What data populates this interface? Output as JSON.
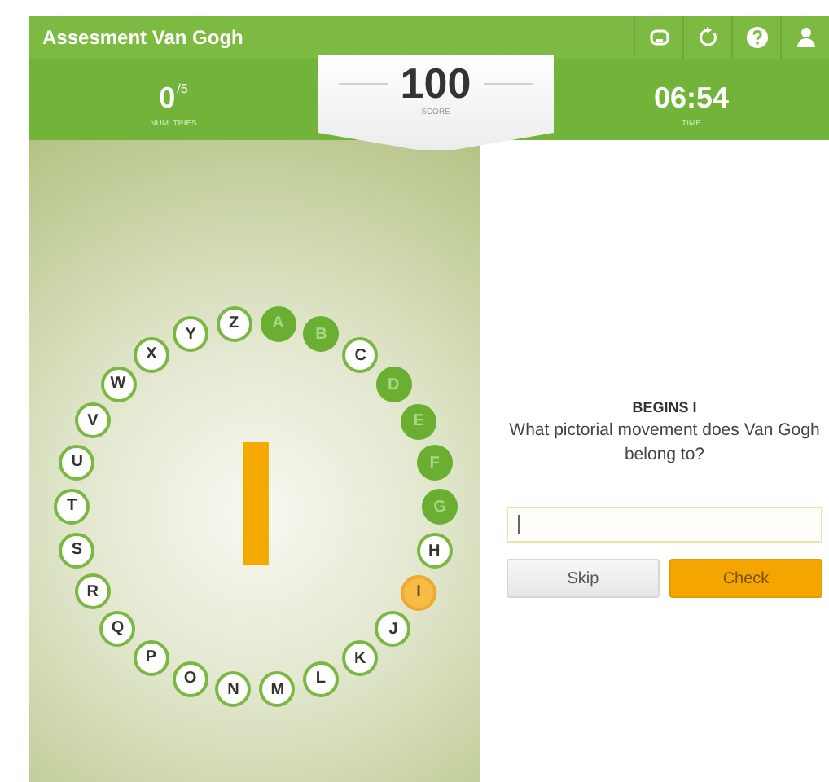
{
  "window": {
    "title": "Assesment Van Gogh"
  },
  "stats": {
    "tries": "0",
    "tries_max": "/5",
    "tries_label": "NUM. TRIES",
    "score": "100",
    "score_label": "SCORE",
    "time": "06:54",
    "time_label": "TIME"
  },
  "wheel": {
    "current": "I",
    "letters": [
      {
        "letter": "A",
        "kind": "correct"
      },
      {
        "letter": "B",
        "kind": "correct"
      },
      {
        "letter": "C",
        "kind": "pending"
      },
      {
        "letter": "D",
        "kind": "correct"
      },
      {
        "letter": "E",
        "kind": "correct"
      },
      {
        "letter": "F",
        "kind": "correct"
      },
      {
        "letter": "G",
        "kind": "correct"
      },
      {
        "letter": "H",
        "kind": "pending"
      },
      {
        "letter": "I",
        "kind": "current"
      },
      {
        "letter": "J",
        "kind": "pending"
      },
      {
        "letter": "K",
        "kind": "pending"
      },
      {
        "letter": "L",
        "kind": "pending"
      },
      {
        "letter": "M",
        "kind": "pending"
      },
      {
        "letter": "N",
        "kind": "pending"
      },
      {
        "letter": "O",
        "kind": "pending"
      },
      {
        "letter": "P",
        "kind": "pending"
      },
      {
        "letter": "Q",
        "kind": "pending"
      },
      {
        "letter": "R",
        "kind": "pending"
      },
      {
        "letter": "S",
        "kind": "pending"
      },
      {
        "letter": "T",
        "kind": "pending"
      },
      {
        "letter": "U",
        "kind": "pending"
      },
      {
        "letter": "V",
        "kind": "pending"
      },
      {
        "letter": "W",
        "kind": "pending"
      },
      {
        "letter": "X",
        "kind": "pending"
      },
      {
        "letter": "Y",
        "kind": "pending"
      },
      {
        "letter": "Z",
        "kind": "pending"
      }
    ]
  },
  "question": {
    "heading": "BEGINS I",
    "text": "What pictorial movement does Van Gogh belong to?"
  },
  "buttons": [
    {
      "label": "Skip",
      "kind": "secondary"
    },
    {
      "label": "Check",
      "kind": "primary"
    }
  ]
}
